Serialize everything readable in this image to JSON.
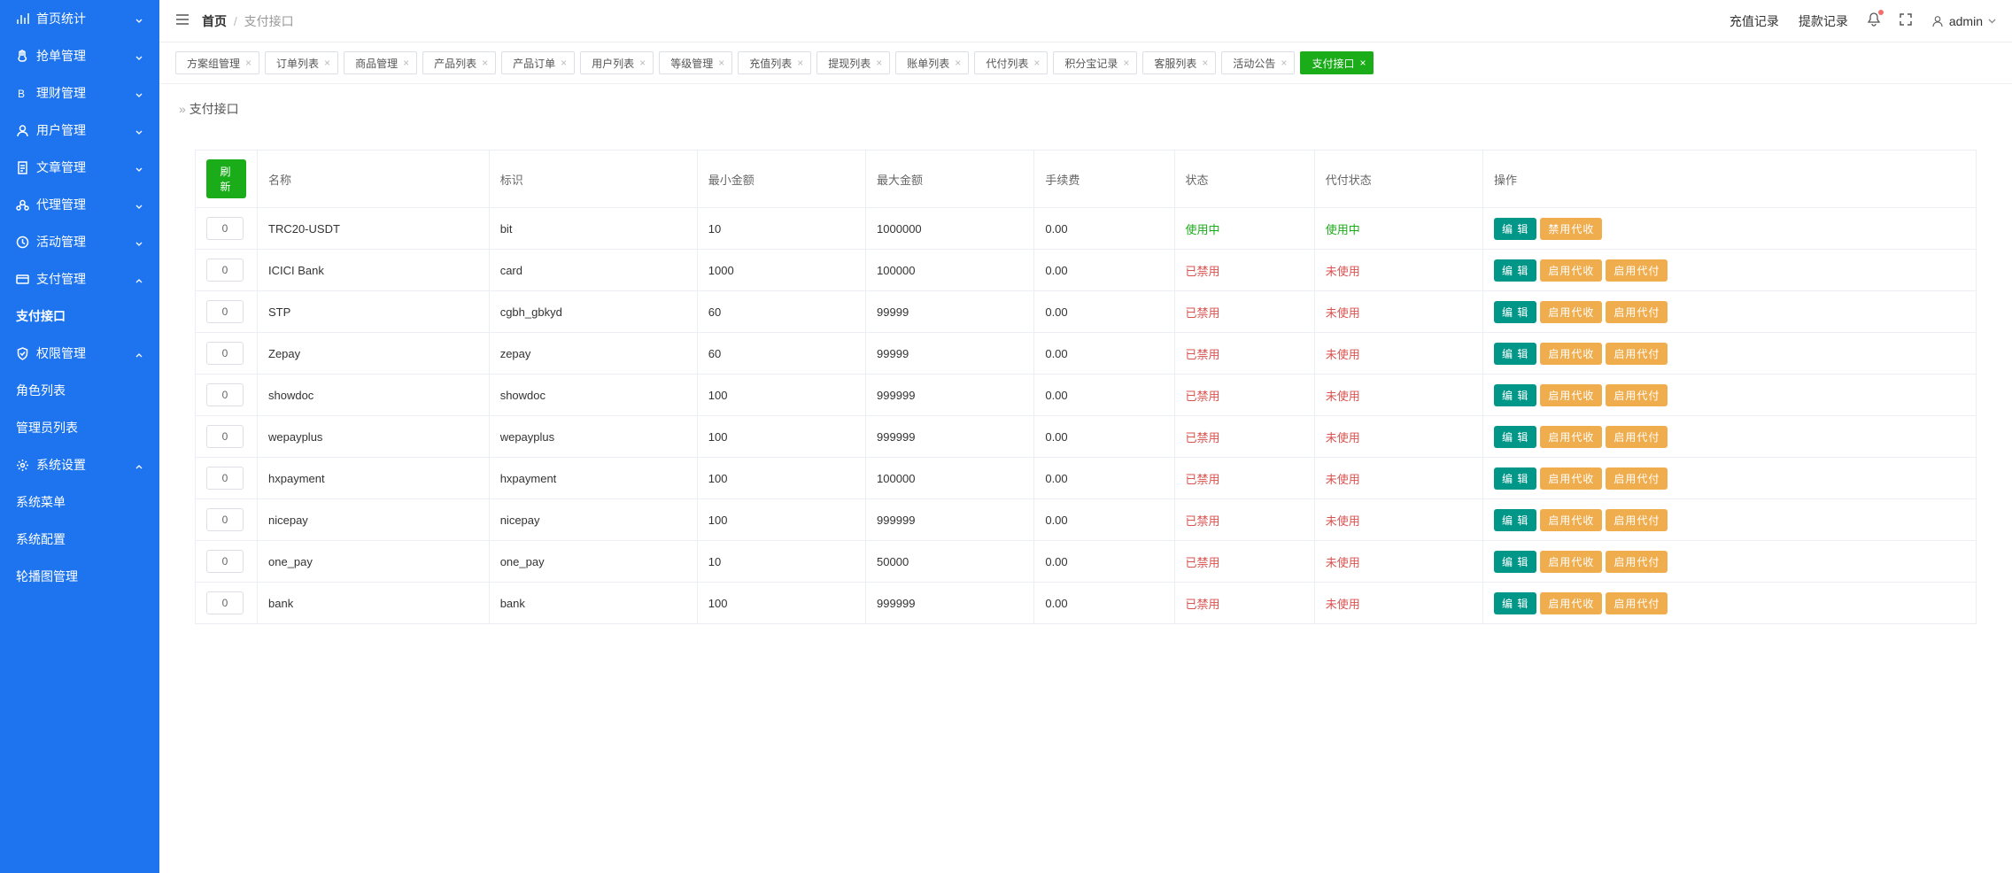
{
  "sidebar": {
    "groups": [
      {
        "icon": "chart",
        "label": "首页统计",
        "open": false,
        "items": []
      },
      {
        "icon": "hand",
        "label": "抢单管理",
        "open": false,
        "items": []
      },
      {
        "icon": "coin",
        "label": "理财管理",
        "open": false,
        "items": []
      },
      {
        "icon": "user",
        "label": "用户管理",
        "open": false,
        "items": []
      },
      {
        "icon": "doc",
        "label": "文章管理",
        "open": false,
        "items": []
      },
      {
        "icon": "agent",
        "label": "代理管理",
        "open": false,
        "items": []
      },
      {
        "icon": "clock",
        "label": "活动管理",
        "open": false,
        "items": []
      },
      {
        "icon": "card",
        "label": "支付管理",
        "open": true,
        "items": [
          {
            "label": "支付接口",
            "active": true
          }
        ]
      },
      {
        "icon": "shield",
        "label": "权限管理",
        "open": true,
        "items": [
          {
            "label": "角色列表",
            "active": false
          },
          {
            "label": "管理员列表",
            "active": false
          }
        ]
      },
      {
        "icon": "gear",
        "label": "系统设置",
        "open": true,
        "items": [
          {
            "label": "系统菜单",
            "active": false
          },
          {
            "label": "系统配置",
            "active": false
          },
          {
            "label": "轮播图管理",
            "active": false
          }
        ]
      }
    ]
  },
  "topbar": {
    "breadcrumb_home": "首页",
    "breadcrumb_current": "支付接口",
    "link_recharge": "充值记录",
    "link_withdraw": "提款记录",
    "username": "admin"
  },
  "tabs": [
    {
      "label": "方案组管理",
      "active": false,
      "closable": true
    },
    {
      "label": "订单列表",
      "active": false,
      "closable": true
    },
    {
      "label": "商品管理",
      "active": false,
      "closable": true
    },
    {
      "label": "产品列表",
      "active": false,
      "closable": true
    },
    {
      "label": "产品订单",
      "active": false,
      "closable": true
    },
    {
      "label": "用户列表",
      "active": false,
      "closable": true
    },
    {
      "label": "等级管理",
      "active": false,
      "closable": true
    },
    {
      "label": "充值列表",
      "active": false,
      "closable": true
    },
    {
      "label": "提现列表",
      "active": false,
      "closable": true
    },
    {
      "label": "账单列表",
      "active": false,
      "closable": true
    },
    {
      "label": "代付列表",
      "active": false,
      "closable": true
    },
    {
      "label": "积分宝记录",
      "active": false,
      "closable": true
    },
    {
      "label": "客服列表",
      "active": false,
      "closable": true
    },
    {
      "label": "活动公告",
      "active": false,
      "closable": true
    },
    {
      "label": "支付接口",
      "active": true,
      "closable": true
    }
  ],
  "page": {
    "title": "支付接口",
    "refresh_label": "刷 新",
    "columns": {
      "name": "名称",
      "ident": "标识",
      "min": "最小金额",
      "max": "最大金额",
      "fee": "手续费",
      "status": "状态",
      "pay_status": "代付状态",
      "ops": "操作"
    },
    "btn_edit": "编 辑",
    "btn_disable_pay": "禁用代收",
    "btn_enable_recv": "启用代收",
    "btn_enable_pay": "启用代付",
    "rows": [
      {
        "sort": "0",
        "name": "TRC20-USDT",
        "ident": "bit",
        "min": "10",
        "max": "1000000",
        "fee": "0.00",
        "status": "使用中",
        "status_cls": "using",
        "pay_status": "使用中",
        "pay_cls": "using",
        "ops": [
          "edit",
          "disable_pay"
        ]
      },
      {
        "sort": "0",
        "name": "ICICI Bank",
        "ident": "card",
        "min": "1000",
        "max": "100000",
        "fee": "0.00",
        "status": "已禁用",
        "status_cls": "disabled",
        "pay_status": "未使用",
        "pay_cls": "unused",
        "ops": [
          "edit",
          "enable_recv",
          "enable_pay"
        ]
      },
      {
        "sort": "0",
        "name": "STP",
        "ident": "cgbh_gbkyd",
        "min": "60",
        "max": "99999",
        "fee": "0.00",
        "status": "已禁用",
        "status_cls": "disabled",
        "pay_status": "未使用",
        "pay_cls": "unused",
        "ops": [
          "edit",
          "enable_recv",
          "enable_pay"
        ]
      },
      {
        "sort": "0",
        "name": "Zepay",
        "ident": "zepay",
        "min": "60",
        "max": "99999",
        "fee": "0.00",
        "status": "已禁用",
        "status_cls": "disabled",
        "pay_status": "未使用",
        "pay_cls": "unused",
        "ops": [
          "edit",
          "enable_recv",
          "enable_pay"
        ]
      },
      {
        "sort": "0",
        "name": "showdoc",
        "ident": "showdoc",
        "min": "100",
        "max": "999999",
        "fee": "0.00",
        "status": "已禁用",
        "status_cls": "disabled",
        "pay_status": "未使用",
        "pay_cls": "unused",
        "ops": [
          "edit",
          "enable_recv",
          "enable_pay"
        ]
      },
      {
        "sort": "0",
        "name": "wepayplus",
        "ident": "wepayplus",
        "min": "100",
        "max": "999999",
        "fee": "0.00",
        "status": "已禁用",
        "status_cls": "disabled",
        "pay_status": "未使用",
        "pay_cls": "unused",
        "ops": [
          "edit",
          "enable_recv",
          "enable_pay"
        ]
      },
      {
        "sort": "0",
        "name": "hxpayment",
        "ident": "hxpayment",
        "min": "100",
        "max": "100000",
        "fee": "0.00",
        "status": "已禁用",
        "status_cls": "disabled",
        "pay_status": "未使用",
        "pay_cls": "unused",
        "ops": [
          "edit",
          "enable_recv",
          "enable_pay"
        ]
      },
      {
        "sort": "0",
        "name": "nicepay",
        "ident": "nicepay",
        "min": "100",
        "max": "999999",
        "fee": "0.00",
        "status": "已禁用",
        "status_cls": "disabled",
        "pay_status": "未使用",
        "pay_cls": "unused",
        "ops": [
          "edit",
          "enable_recv",
          "enable_pay"
        ]
      },
      {
        "sort": "0",
        "name": "one_pay",
        "ident": "one_pay",
        "min": "10",
        "max": "50000",
        "fee": "0.00",
        "status": "已禁用",
        "status_cls": "disabled",
        "pay_status": "未使用",
        "pay_cls": "unused",
        "ops": [
          "edit",
          "enable_recv",
          "enable_pay"
        ]
      },
      {
        "sort": "0",
        "name": "bank",
        "ident": "bank",
        "min": "100",
        "max": "999999",
        "fee": "0.00",
        "status": "已禁用",
        "status_cls": "disabled",
        "pay_status": "未使用",
        "pay_cls": "unused",
        "ops": [
          "edit",
          "enable_recv",
          "enable_pay"
        ]
      }
    ]
  }
}
